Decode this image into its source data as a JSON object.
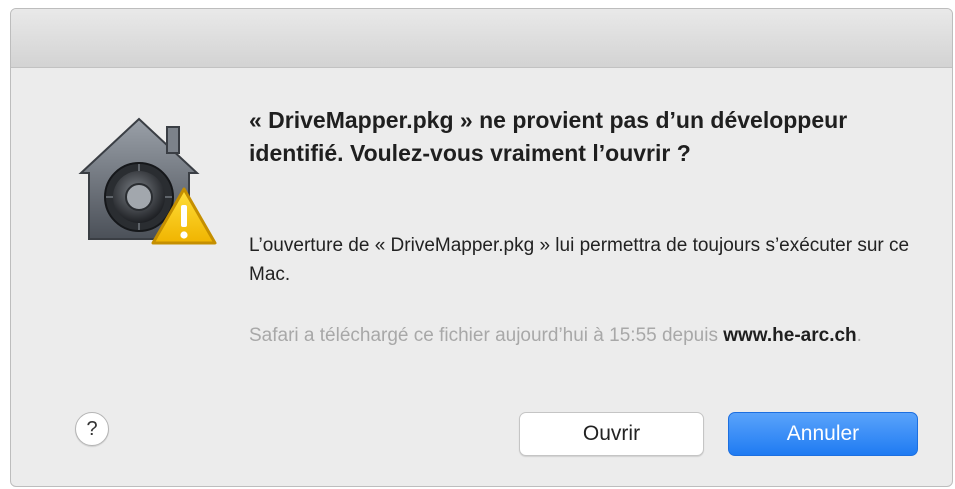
{
  "dialog": {
    "headline": "« DriveMapper.pkg » ne provient pas d’un développeur identifié. Voulez-vous vraiment l’ouvrir ?",
    "message": "L’ouverture de « DriveMapper.pkg » lui permettra de toujours s’exécuter sur ce Mac.",
    "info_prefix": "Safari a téléchargé ce fichier aujourd’hui à 15:55 depuis ",
    "info_host": "www.he-arc.ch",
    "info_suffix": ".",
    "icon": "gatekeeper-security-icon",
    "warning_icon": "warning-triangle-icon"
  },
  "buttons": {
    "help_label": "?",
    "open_label": "Ouvrir",
    "cancel_label": "Annuler"
  },
  "colors": {
    "accent": "#1f7bf2",
    "warning": "#f5c000",
    "dialog_bg": "#ececec"
  }
}
